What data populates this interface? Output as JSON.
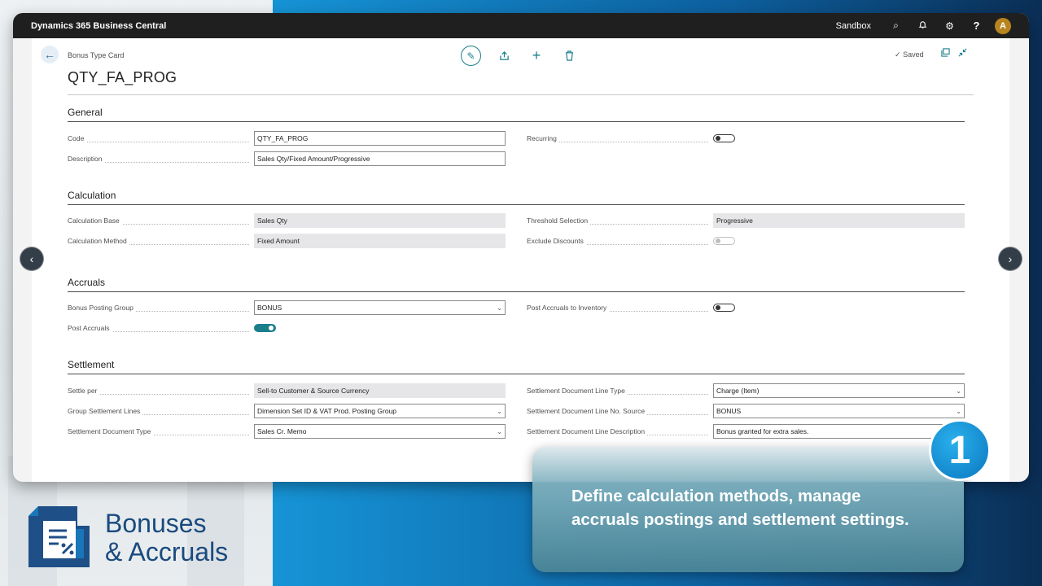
{
  "app": {
    "title": "Dynamics 365 Business Central",
    "environment": "Sandbox",
    "avatar_initial": "A",
    "help_glyph": "?"
  },
  "card": {
    "breadcrumb": "Bonus Type Card",
    "title": "QTY_FA_PROG",
    "status": "Saved",
    "status_check": "✓"
  },
  "icons": {
    "search": "⌕",
    "bell": "🔔",
    "gear": "⚙",
    "edit": "✎",
    "share": "⇪",
    "add": "+",
    "delete": "🗑",
    "open": "⧉",
    "collapse": "⤡",
    "back": "←",
    "prev": "‹",
    "next": "›",
    "chevron": "⌄"
  },
  "sections": {
    "general": {
      "title": "General",
      "code_label": "Code",
      "code_value": "QTY_FA_PROG",
      "description_label": "Description",
      "description_value": "Sales Qty/Fixed Amount/Progressive",
      "recurring_label": "Recurring",
      "recurring_on": false
    },
    "calculation": {
      "title": "Calculation",
      "base_label": "Calculation Base",
      "base_value": "Sales Qty",
      "method_label": "Calculation Method",
      "method_value": "Fixed Amount",
      "threshold_label": "Threshold Selection",
      "threshold_value": "Progressive",
      "exclude_label": "Exclude Discounts",
      "exclude_on": false
    },
    "accruals": {
      "title": "Accruals",
      "posting_group_label": "Bonus Posting Group",
      "posting_group_value": "BONUS",
      "post_accruals_label": "Post Accruals",
      "post_accruals_on": true,
      "to_inventory_label": "Post Accruals to Inventory",
      "to_inventory_on": false
    },
    "settlement": {
      "title": "Settlement",
      "settle_per_label": "Settle per",
      "settle_per_value": "Sell-to Customer & Source Currency",
      "group_lines_label": "Group Settlement Lines",
      "group_lines_value": "Dimension Set ID & VAT Prod. Posting Group",
      "doc_type_label": "Settlement Document Type",
      "doc_type_value": "Sales Cr. Memo",
      "line_type_label": "Settlement Document Line Type",
      "line_type_value": "Charge (Item)",
      "line_no_label": "Settlement Document Line No. Source",
      "line_no_value": "BONUS",
      "line_desc_label": "Settlement Document Line Description",
      "line_desc_value": "Bonus granted for extra sales."
    }
  },
  "promo": {
    "step": "1",
    "line1": "Define calculation methods, manage",
    "line2": "accruals postings and settlement settings.",
    "brand_line1": "Bonuses",
    "brand_line2": "& Accruals"
  },
  "colors": {
    "accent": "#1a7f8a",
    "brand": "#1a4a7e",
    "badge": "#0a77c0"
  }
}
